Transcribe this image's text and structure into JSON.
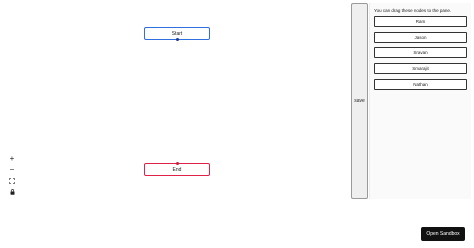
{
  "nodes": {
    "start_label": "Start",
    "end_label": "End"
  },
  "controls": {
    "zoom_in": "+",
    "zoom_out": "−",
    "fit_view": "⛶",
    "lock": "🔒"
  },
  "save": {
    "label": "save"
  },
  "pane": {
    "description": "You can drag these nodes to the pane.",
    "items": [
      {
        "label": "Ram"
      },
      {
        "label": "Jason"
      },
      {
        "label": "Sravan"
      },
      {
        "label": "Smarajit"
      },
      {
        "label": "Nathan"
      }
    ]
  },
  "sandbox": {
    "label": "Open Sandbox"
  }
}
